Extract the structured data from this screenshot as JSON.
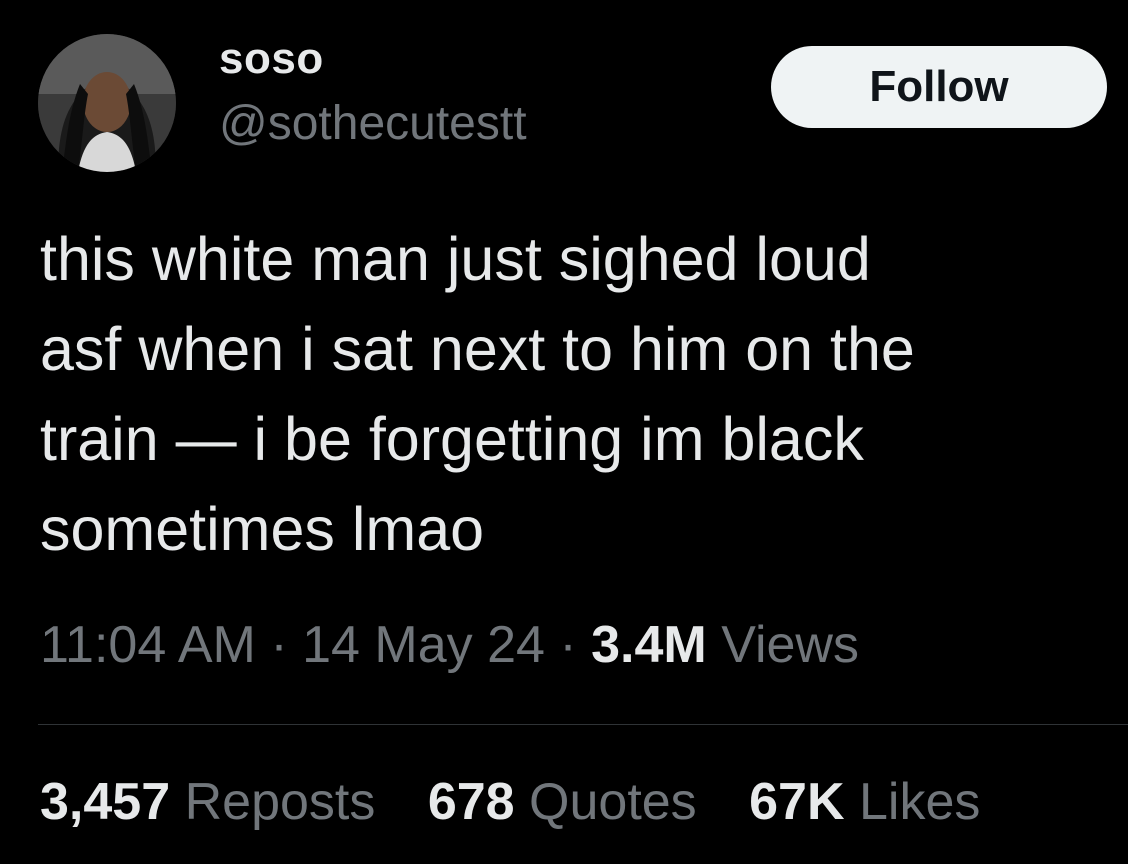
{
  "author": {
    "display_name": "soso",
    "handle": "@sothecutestt",
    "avatar_icon": "profile-photo"
  },
  "follow_label": "Follow",
  "tweet": {
    "lines": [
      "this white man just sighed loud",
      "asf when i sat next to him on the",
      "train — i be forgetting im black",
      "sometimes lmao"
    ]
  },
  "meta": {
    "time": "11:04 AM",
    "separator": "·",
    "date": "14 May 24",
    "views_count": "3.4M",
    "views_label": "Views"
  },
  "stats": {
    "reposts_count": "3,457",
    "reposts_label": "Reposts",
    "quotes_count": "678",
    "quotes_label": "Quotes",
    "likes_count": "67K",
    "likes_label": "Likes"
  },
  "colors": {
    "background": "#000000",
    "primary_text": "#e7e9ea",
    "secondary_text": "#71767b",
    "button_bg": "#eff3f4",
    "divider": "#2f3336"
  }
}
